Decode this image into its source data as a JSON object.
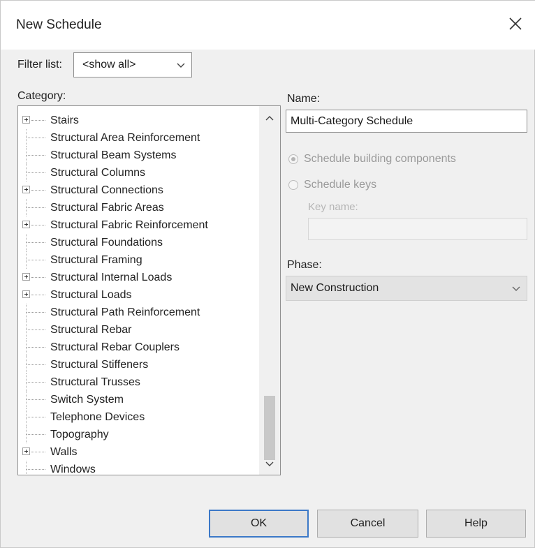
{
  "window": {
    "title": "New Schedule"
  },
  "filter": {
    "label": "Filter list:",
    "value": "<show all>"
  },
  "category": {
    "label": "Category:",
    "items": [
      {
        "label": "Stairs",
        "expandable": true
      },
      {
        "label": "Structural Area Reinforcement",
        "expandable": false
      },
      {
        "label": "Structural Beam Systems",
        "expandable": false
      },
      {
        "label": "Structural Columns",
        "expandable": false
      },
      {
        "label": "Structural Connections",
        "expandable": true
      },
      {
        "label": "Structural Fabric Areas",
        "expandable": false
      },
      {
        "label": "Structural Fabric Reinforcement",
        "expandable": true
      },
      {
        "label": "Structural Foundations",
        "expandable": false
      },
      {
        "label": "Structural Framing",
        "expandable": false
      },
      {
        "label": "Structural Internal Loads",
        "expandable": true
      },
      {
        "label": "Structural Loads",
        "expandable": true
      },
      {
        "label": "Structural Path Reinforcement",
        "expandable": false
      },
      {
        "label": "Structural Rebar",
        "expandable": false
      },
      {
        "label": "Structural Rebar Couplers",
        "expandable": false
      },
      {
        "label": "Structural Stiffeners",
        "expandable": false
      },
      {
        "label": "Structural Trusses",
        "expandable": false
      },
      {
        "label": "Switch System",
        "expandable": false
      },
      {
        "label": "Telephone Devices",
        "expandable": false
      },
      {
        "label": "Topography",
        "expandable": false
      },
      {
        "label": "Walls",
        "expandable": true
      },
      {
        "label": "Windows",
        "expandable": false
      }
    ]
  },
  "name": {
    "label": "Name:",
    "value": "Multi-Category Schedule"
  },
  "options": {
    "schedule_components": "Schedule building components",
    "schedule_keys": "Schedule keys",
    "key_name_label": "Key name:"
  },
  "phase": {
    "label": "Phase:",
    "value": "New Construction"
  },
  "buttons": {
    "ok": "OK",
    "cancel": "Cancel",
    "help": "Help"
  },
  "colors": {
    "default_button_border": "#3b78c7",
    "dialog_bg": "#f0f0f0"
  }
}
